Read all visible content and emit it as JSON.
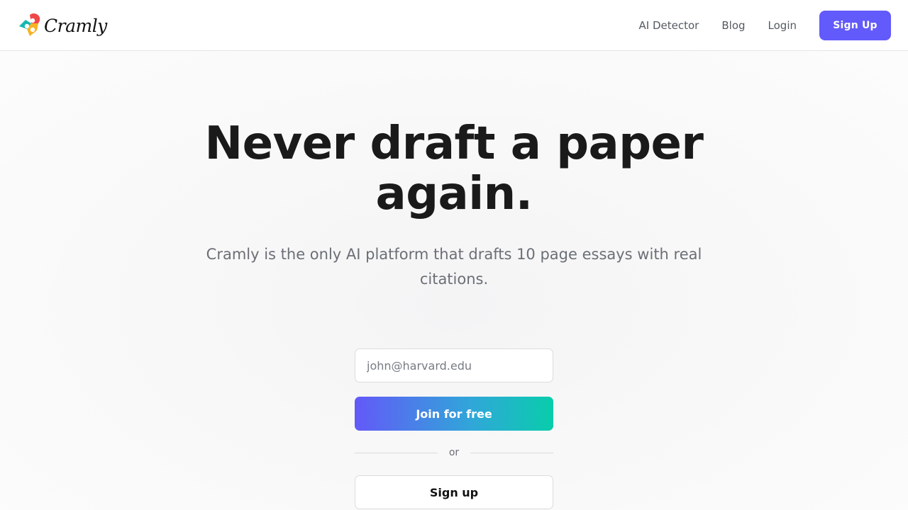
{
  "brand": {
    "name": "Cramly",
    "logo_icon": "heart-logo-icon",
    "logo_colors": [
      "#f04747",
      "#16b8b0",
      "#f6b324"
    ]
  },
  "nav": {
    "links": [
      "AI Detector",
      "Blog",
      "Login"
    ],
    "signup_label": "Sign Up",
    "accent": "#625afa"
  },
  "hero": {
    "title": "Never draft a paper again.",
    "subtitle": "Cramly is the only AI platform that drafts 10 page essays with real citations."
  },
  "form": {
    "email_placeholder": "john@harvard.edu",
    "join_label": "Join for free",
    "divider_label": "or",
    "secondary_label": "Sign up"
  }
}
